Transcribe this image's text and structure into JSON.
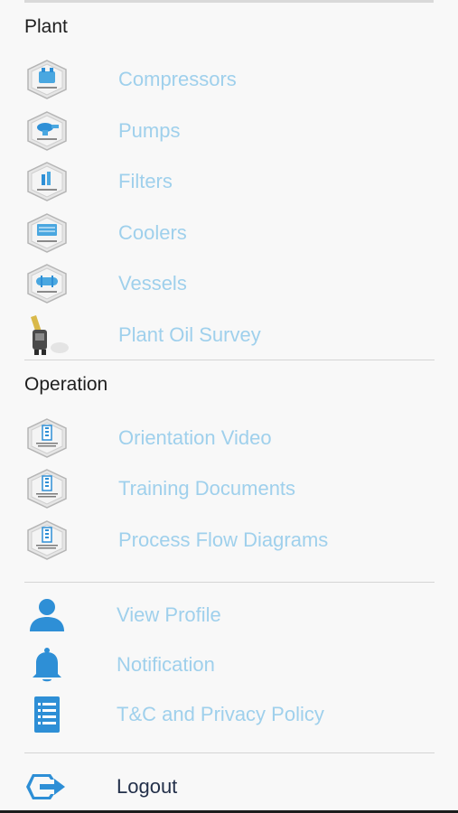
{
  "plant": {
    "title": "Plant",
    "items": [
      {
        "label": "Compressors",
        "icon": "compressor-icon",
        "badge": "COMPRESSOR"
      },
      {
        "label": "Pumps",
        "icon": "pump-icon",
        "badge": "PUMP"
      },
      {
        "label": "Filters",
        "icon": "filter-icon",
        "badge": "FILTERS"
      },
      {
        "label": "Coolers",
        "icon": "cooler-icon",
        "badge": "COOLERS"
      },
      {
        "label": "Vessels",
        "icon": "vessel-icon",
        "badge": "VESSELS"
      },
      {
        "label": "Plant Oil Survey",
        "icon": "oil-survey-icon"
      }
    ]
  },
  "operation": {
    "title": "Operation",
    "items": [
      {
        "label": "Orientation Video",
        "icon": "document-icon",
        "badge": "CONTROL ROOM DOCUMENTS"
      },
      {
        "label": "Training Documents",
        "icon": "document-icon",
        "badge": "CONTROL ROOM DOCUMENTS"
      },
      {
        "label": "Process Flow Diagrams",
        "icon": "document-icon",
        "badge": "CONTROL ROOM DOCUMENTS"
      }
    ]
  },
  "account": {
    "items": [
      {
        "label": "View Profile",
        "icon": "user-icon"
      },
      {
        "label": "Notification",
        "icon": "bell-icon"
      },
      {
        "label": "T&C and Privacy Policy",
        "icon": "policy-doc-icon"
      }
    ],
    "logout": {
      "label": "Logout",
      "icon": "logout-icon"
    }
  },
  "colors": {
    "link": "#9fd0ec",
    "icon_blue": "#2e8fd6",
    "heading": "#1e1e1e",
    "logout_text": "#23304a"
  }
}
